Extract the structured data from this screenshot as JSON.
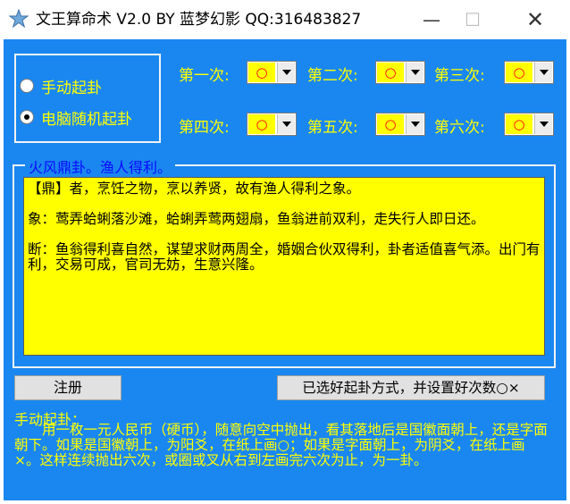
{
  "window": {
    "title": "文王算命术 V2.0 BY 蓝梦幻影 QQ:316483827",
    "minimize": "—",
    "maximize": "☐",
    "close": "✕"
  },
  "mode": {
    "options": [
      {
        "label": "手动起卦",
        "checked": false
      },
      {
        "label": "电脑随机起卦",
        "checked": true
      }
    ]
  },
  "counts": [
    {
      "label": "第一次:",
      "value": "○"
    },
    {
      "label": "第二次:",
      "value": "○"
    },
    {
      "label": "第三次:",
      "value": "○"
    },
    {
      "label": "第四次:",
      "value": "○"
    },
    {
      "label": "第五次:",
      "value": "○"
    },
    {
      "label": "第六次:",
      "value": "○"
    }
  ],
  "result": {
    "title": "火风鼎卦。渔人得利。",
    "paragraphs": [
      "【鼎】者，烹饪之物，烹以养贤，故有渔人得利之象。",
      "象：莺弄蛤蜊落沙滩，蛤蜊弄莺两翅扇，鱼翁进前双利，走失行人即日还。",
      "断：鱼翁得利喜自然，谋望求财两周全，婚姻合伙双得利，卦者适值喜气添。出门有利，交易可成，官司无妨，生意兴隆。"
    ]
  },
  "buttons": {
    "register": "注册",
    "status": "已选好起卦方式，并设置好次数○×"
  },
  "help": {
    "title": "手动起卦：",
    "text": "用一枚一元人民币（硬币），随意向空中抛出，看其落地后是国徽面朝上，还是字面朝下。如果是国徽朝上，为阳爻，在纸上画○；如果是字面朝上，为阴爻，在纸上画×。这样连续抛出六次，或圈或叉从右到左画完六次为止，为一卦。"
  },
  "colors": {
    "client_bg": "#1a87f0",
    "label_yellow": "#ffff00",
    "result_title_blue": "#0a0aff",
    "combo_value_red": "#ff0000"
  }
}
